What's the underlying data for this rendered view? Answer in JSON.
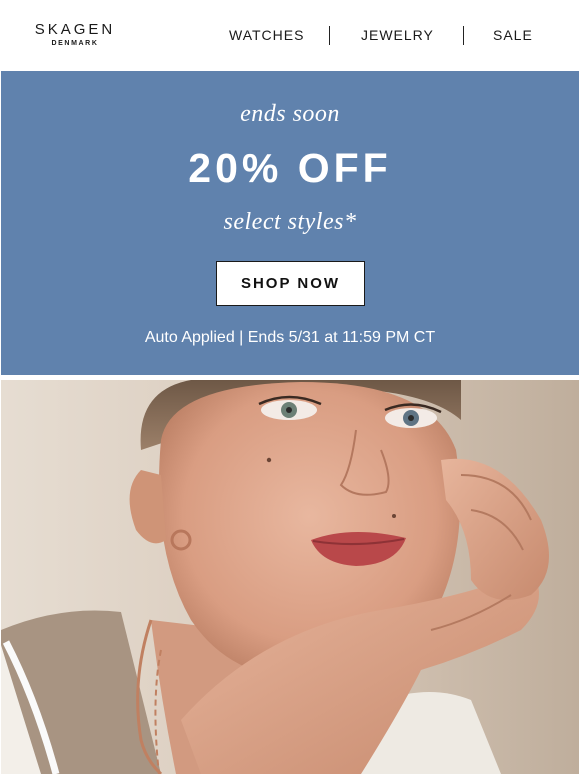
{
  "header": {
    "logo_main": "SKAGEN",
    "logo_sub": "DENMARK",
    "nav": [
      {
        "label": "WATCHES"
      },
      {
        "label": "JEWELRY"
      },
      {
        "label": "SALE"
      }
    ]
  },
  "promo": {
    "eyebrow": "ends soon",
    "headline": "20% OFF",
    "subhead": "select styles*",
    "cta_label": "SHOP NOW",
    "fine_print": "Auto Applied | Ends 5/31 at 11:59 PM CT",
    "background_color": "#6082ad"
  },
  "hero": {
    "image_subject": "model-with-earrings-and-necklace"
  }
}
